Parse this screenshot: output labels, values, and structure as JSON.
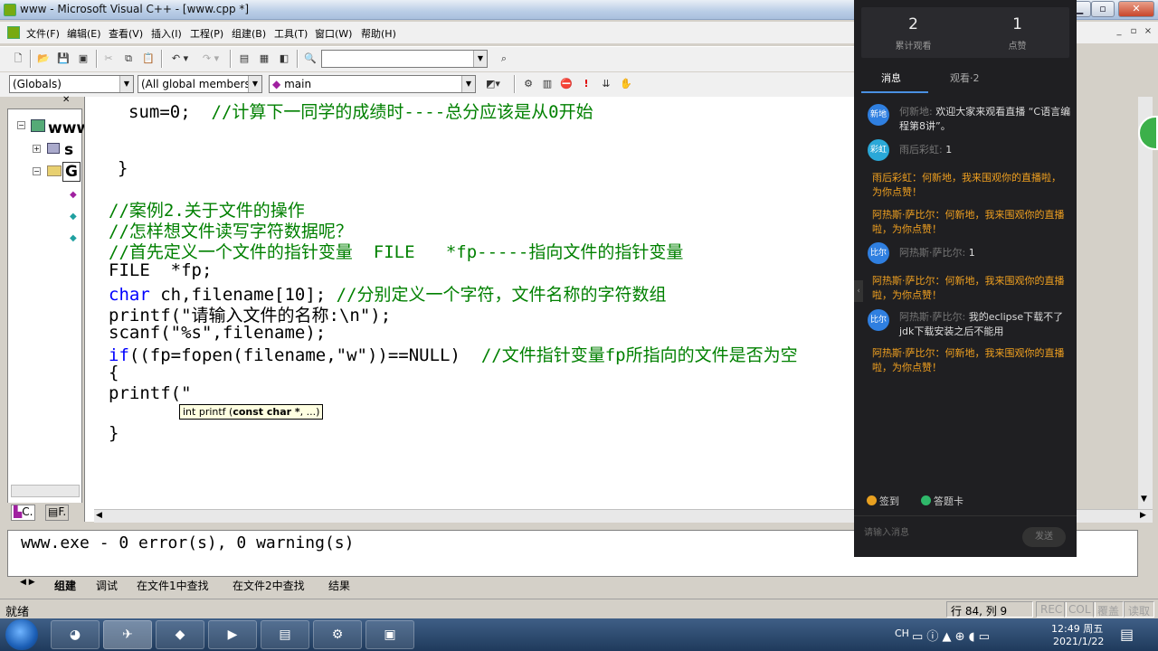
{
  "window": {
    "title": "www - Microsoft Visual C++ - [www.cpp *]",
    "mdi_buttons": [
      "_",
      "▫",
      "×"
    ]
  },
  "menu": [
    "文件(F)",
    "编辑(E)",
    "查看(V)",
    "插入(I)",
    "工程(P)",
    "组建(B)",
    "工具(T)",
    "窗口(W)",
    "帮助(H)"
  ],
  "toolbar": {
    "find_value": "",
    "class_combo": "(Globals)",
    "members_combo": "(All global members",
    "function_combo": "main"
  },
  "workspace": {
    "tree": [
      "www",
      "s",
      "G"
    ],
    "tabs": [
      "C.",
      "F."
    ]
  },
  "editor": {
    "lines": [
      {
        "parts": [
          {
            "t": "sum=0;  ",
            "c": ""
          },
          {
            "t": "//计算下一同学的成绩时----总分应该是从0开始",
            "c": "cm"
          }
        ]
      },
      {
        "parts": [
          {
            "t": "}",
            "c": ""
          }
        ]
      },
      {
        "parts": [
          {
            "t": "//案例2.关于文件的操作",
            "c": "cm"
          }
        ]
      },
      {
        "parts": [
          {
            "t": "//怎样想文件读写字符数据呢？",
            "c": "cm"
          }
        ]
      },
      {
        "parts": [
          {
            "t": "//首先定义一个文件的指针变量  FILE   *fp-----指向文件的指针变量",
            "c": "cm"
          }
        ]
      },
      {
        "parts": [
          {
            "t": "FILE  *fp;",
            "c": ""
          }
        ]
      },
      {
        "parts": [
          {
            "t": "char",
            "c": "kw"
          },
          {
            "t": " ch,filename[10]; ",
            "c": ""
          },
          {
            "t": "//分别定义一个字符，文件名称的字符数组",
            "c": "cm"
          }
        ]
      },
      {
        "parts": [
          {
            "t": "printf(\"请输入文件的名称:\\n\");",
            "c": ""
          }
        ]
      },
      {
        "parts": [
          {
            "t": "scanf(\"%s\",filename);",
            "c": ""
          }
        ]
      },
      {
        "parts": [
          {
            "t": "if",
            "c": "kw"
          },
          {
            "t": "((fp=fopen(filename,\"w\"))==NULL)  ",
            "c": ""
          },
          {
            "t": "//文件指针变量fp所指向的文件是否为空",
            "c": "cm"
          }
        ]
      },
      {
        "parts": [
          {
            "t": "{",
            "c": ""
          }
        ]
      },
      {
        "parts": [
          {
            "t": "printf(\"",
            "c": ""
          }
        ]
      },
      {
        "parts": [
          {
            "t": "}",
            "c": ""
          }
        ]
      }
    ],
    "tooltip_prefix": "int printf (",
    "tooltip_bold": "const char *",
    "tooltip_suffix": ", ...)"
  },
  "output": {
    "text": "www.exe - 0 error(s), 0 warning(s)",
    "tabs": [
      "组建",
      "调试",
      "在文件1中查找",
      "在文件2中查找",
      "结果"
    ]
  },
  "statusbar": {
    "ready": "就绪",
    "position": "行 84, 列 9",
    "indicators": [
      "REC",
      "COL",
      "覆盖",
      "读取"
    ]
  },
  "taskbar": {
    "tray_lang": "CH",
    "time": "12:49 周五",
    "date": "2021/1/22"
  },
  "chat": {
    "stats": [
      {
        "value": "2",
        "label": "累计观看"
      },
      {
        "value": "1",
        "label": "点赞"
      }
    ],
    "tabs": [
      "消息",
      "观看·2"
    ],
    "messages": [
      {
        "avatar": "新地",
        "name": "何新地:",
        "text": "欢迎大家来观看直播 “C语言编程第8讲”。"
      },
      {
        "avatar": "彩虹",
        "name": "雨后彩虹:",
        "text": "1"
      }
    ],
    "gifts": [
      "雨后彩虹：何新地，我来围观你的直播啦，为你点赞！",
      "阿热斯&middot;萨比尔：何新地，我来围观你的直播啦，为你点赞！"
    ],
    "message3": {
      "avatar": "比尔",
      "name": "阿热斯·萨比尔:",
      "text": "1"
    },
    "gift3": "阿热斯&middot;萨比尔：何新地，我来围观你的直播啦，为你点赞！",
    "message4": {
      "avatar": "比尔",
      "name": "阿热斯·萨比尔:",
      "text": "我的eclipse下载不了 jdk下载安装之后不能用"
    },
    "gift4": "阿热斯&middot;萨比尔：何新地，我来围观你的直播啦，为你点赞！",
    "chips": [
      "签到",
      "答题卡"
    ],
    "input_placeholder": "请输入消息",
    "send": "发送",
    "colors": {
      "accent": "#4a90e2",
      "gift": "#f0a020"
    }
  }
}
